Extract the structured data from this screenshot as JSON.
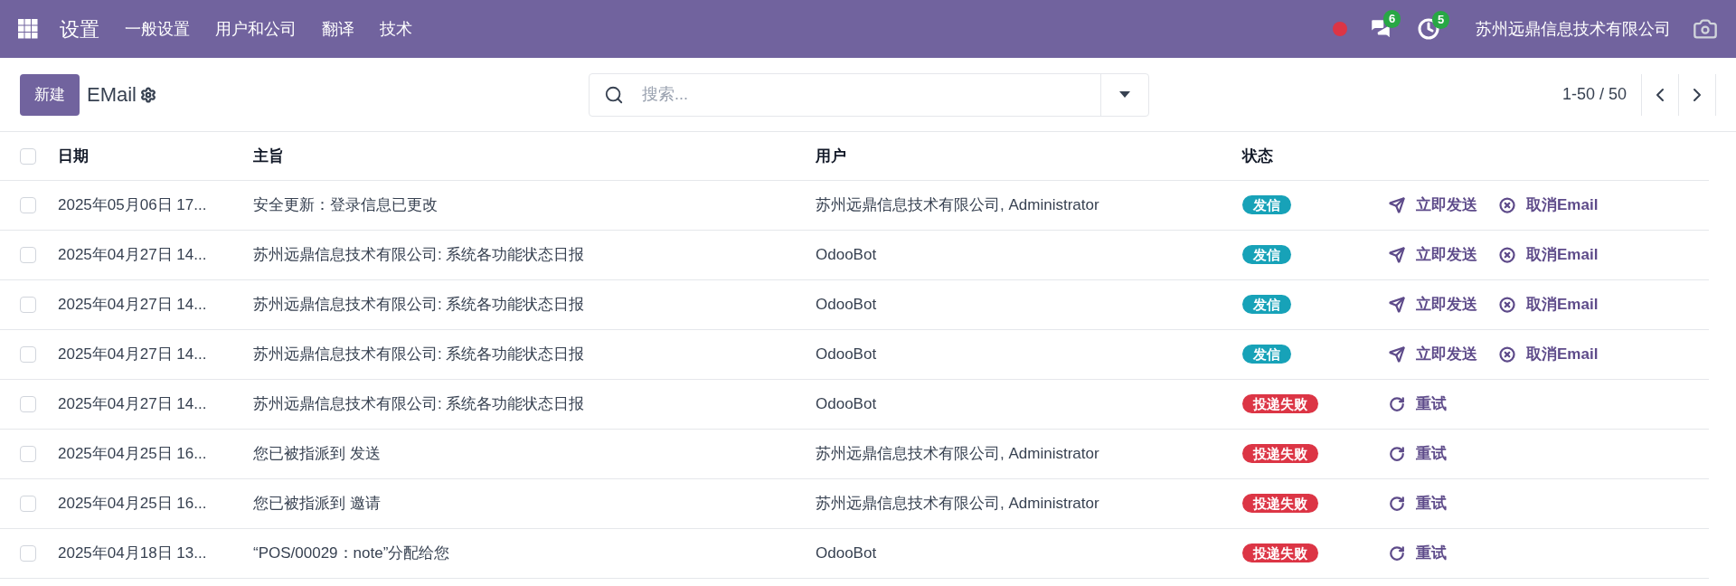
{
  "navbar": {
    "app_title": "设置",
    "menu": [
      "一般设置",
      "用户和公司",
      "翻译",
      "技术"
    ],
    "messages_count": "6",
    "activities_count": "5",
    "company": "苏州远鼎信息技术有限公司"
  },
  "control_panel": {
    "new_button": "新建",
    "title": "EMail",
    "search": {
      "placeholder": "搜索..."
    },
    "pager": "1-50 / 50"
  },
  "table": {
    "select_all": {
      "checked": false
    },
    "columns": [
      "日期",
      "主旨",
      "用户",
      "状态"
    ],
    "rows": [
      {
        "checked": false,
        "date": "2025年05月06日 17...",
        "subject": "安全更新：登录信息已更改",
        "user": "苏州远鼎信息技术有限公司, Administrator",
        "status": {
          "kind": "outgoing",
          "label": "发信"
        },
        "actions": [
          {
            "kind": "send",
            "label": "立即发送"
          },
          {
            "kind": "cancel",
            "label": "取消Email"
          }
        ]
      },
      {
        "checked": false,
        "date": "2025年04月27日 14...",
        "subject": "苏州远鼎信息技术有限公司: 系统各功能状态日报",
        "user": "OdooBot",
        "status": {
          "kind": "outgoing",
          "label": "发信"
        },
        "actions": [
          {
            "kind": "send",
            "label": "立即发送"
          },
          {
            "kind": "cancel",
            "label": "取消Email"
          }
        ]
      },
      {
        "checked": false,
        "date": "2025年04月27日 14...",
        "subject": "苏州远鼎信息技术有限公司: 系统各功能状态日报",
        "user": "OdooBot",
        "status": {
          "kind": "outgoing",
          "label": "发信"
        },
        "actions": [
          {
            "kind": "send",
            "label": "立即发送"
          },
          {
            "kind": "cancel",
            "label": "取消Email"
          }
        ]
      },
      {
        "checked": false,
        "date": "2025年04月27日 14...",
        "subject": "苏州远鼎信息技术有限公司: 系统各功能状态日报",
        "user": "OdooBot",
        "status": {
          "kind": "outgoing",
          "label": "发信"
        },
        "actions": [
          {
            "kind": "send",
            "label": "立即发送"
          },
          {
            "kind": "cancel",
            "label": "取消Email"
          }
        ]
      },
      {
        "checked": false,
        "date": "2025年04月27日 14...",
        "subject": "苏州远鼎信息技术有限公司: 系统各功能状态日报",
        "user": "OdooBot",
        "status": {
          "kind": "failed",
          "label": "投递失败"
        },
        "actions": [
          {
            "kind": "retry",
            "label": "重试"
          }
        ]
      },
      {
        "checked": false,
        "date": "2025年04月25日 16...",
        "subject": "您已被指派到 发送",
        "user": "苏州远鼎信息技术有限公司, Administrator",
        "status": {
          "kind": "failed",
          "label": "投递失败"
        },
        "actions": [
          {
            "kind": "retry",
            "label": "重试"
          }
        ]
      },
      {
        "checked": false,
        "date": "2025年04月25日 16...",
        "subject": "您已被指派到 邀请",
        "user": "苏州远鼎信息技术有限公司, Administrator",
        "status": {
          "kind": "failed",
          "label": "投递失败"
        },
        "actions": [
          {
            "kind": "retry",
            "label": "重试"
          }
        ]
      },
      {
        "checked": false,
        "date": "2025年04月18日 13...",
        "subject": "“POS/00029：note”分配给您",
        "user": "OdooBot",
        "status": {
          "kind": "failed",
          "label": "投递失败"
        },
        "actions": [
          {
            "kind": "retry",
            "label": "重试"
          }
        ]
      }
    ]
  }
}
